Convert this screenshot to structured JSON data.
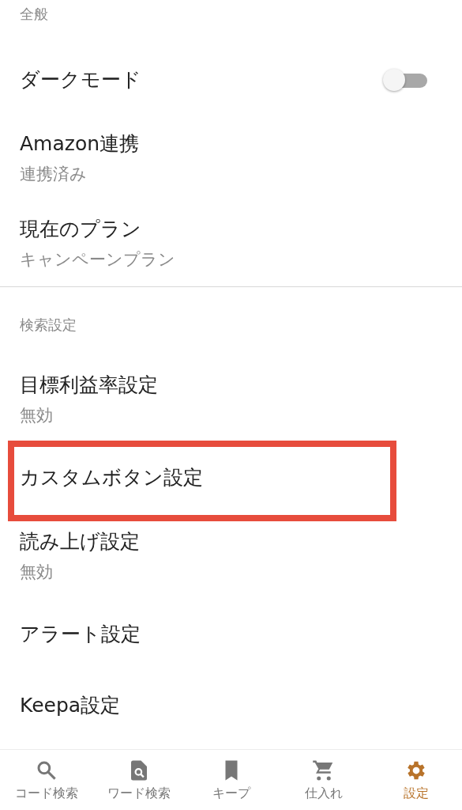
{
  "sections": [
    {
      "header": "全般",
      "items": [
        {
          "kind": "toggle",
          "title": "ダークモード",
          "on": false,
          "highlighted": false
        },
        {
          "kind": "text",
          "title": "Amazon連携",
          "subtitle": "連携済み",
          "highlighted": false
        },
        {
          "kind": "text",
          "title": "現在のプラン",
          "subtitle": "キャンペーンプラン",
          "highlighted": false
        }
      ]
    },
    {
      "header": "検索設定",
      "items": [
        {
          "kind": "text",
          "title": "目標利益率設定",
          "subtitle": "無効",
          "highlighted": false
        },
        {
          "kind": "text",
          "title": "カスタムボタン設定",
          "highlighted": true
        },
        {
          "kind": "text",
          "title": "読み上げ設定",
          "subtitle": "無効",
          "highlighted": false
        },
        {
          "kind": "text",
          "title": "アラート設定",
          "highlighted": false
        },
        {
          "kind": "text",
          "title": "Keepa設定",
          "highlighted": false
        }
      ]
    }
  ],
  "bottom_nav": [
    {
      "label": "コード検索",
      "selected": false
    },
    {
      "label": "ワード検索",
      "selected": false
    },
    {
      "label": "キープ",
      "selected": false
    },
    {
      "label": "仕入れ",
      "selected": false
    },
    {
      "label": "設定",
      "selected": true
    }
  ]
}
